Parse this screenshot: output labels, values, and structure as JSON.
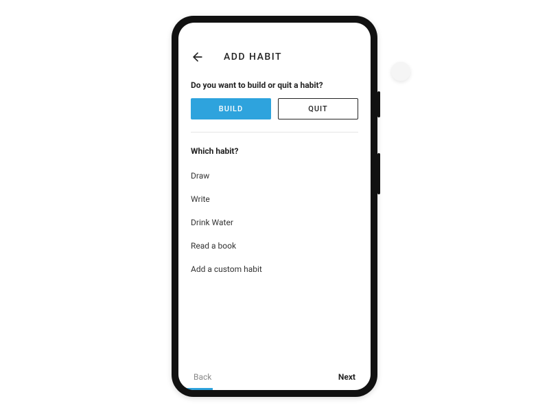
{
  "header": {
    "title": "ADD HABIT"
  },
  "question1": "Do you want to build or quit a habit?",
  "toggle": {
    "build": "BUILD",
    "quit": "QUIT"
  },
  "question2": "Which habit?",
  "habits": [
    "Draw",
    "Write",
    "Drink Water",
    "Read a book",
    "Add a custom habit"
  ],
  "footer": {
    "back": "Back",
    "next": "Next"
  },
  "colors": {
    "accent": "#2ea3dd"
  }
}
